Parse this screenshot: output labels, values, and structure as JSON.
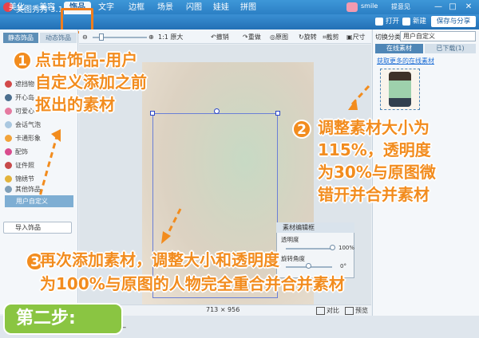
{
  "window": {
    "title": "美图秀秀 3.1.2",
    "user_name": "smile",
    "feedback": "提意见",
    "controls": [
      "—",
      "□",
      "✕"
    ]
  },
  "menu": {
    "tabs": [
      "美化",
      "美容",
      "饰品",
      "文字",
      "边框",
      "场景",
      "闪图",
      "娃娃",
      "拼图"
    ],
    "active_index": 2,
    "actions": {
      "open": "打开",
      "new": "新建",
      "save_share": "保存与分享"
    }
  },
  "left_panel": {
    "tabs": [
      "静态饰品",
      "动态饰品"
    ],
    "items": [
      "遮挡物",
      "开心岛",
      "可爱心",
      "会话气泡",
      "卡通形象",
      "配饰",
      "证件照",
      "锦绣节",
      "其他饰品"
    ],
    "custom": "用户自定义",
    "import_button": "导入饰品"
  },
  "toolbar": {
    "zoom_label": "1:1 原大",
    "undo": "撤销",
    "redo": "重做",
    "original": "原图",
    "rotate": "旋转",
    "crop": "截剪",
    "size": "尺寸"
  },
  "status": {
    "size_text": "713 × 956",
    "compare": "对比",
    "preview": "预览"
  },
  "material_editor": {
    "title": "素材编辑框",
    "opacity_label": "透明度",
    "opacity_value": "100%",
    "rotation_label": "旋转角度",
    "rotation_value": "0°"
  },
  "right_panel": {
    "category_label": "切换分类",
    "category_value": "用户自定义",
    "tabs": [
      "在线素材",
      "已下载(1)"
    ],
    "link": "获取更多的在线素材"
  },
  "annotations": {
    "step1_num": "1",
    "step1_lines": [
      "点击饰品-用户",
      "自定义添加之前",
      "抠出的素材"
    ],
    "step2_num": "2",
    "step2_lines": [
      "调整素材大小为",
      "115%，透明度",
      "为30%与原图微",
      "错开并合并素材"
    ],
    "step3_num": "3",
    "step3_lines": [
      "再次添加素材，调整大小和透明度",
      "为100%与原图的人物完全重合并合并素材"
    ],
    "step_badge": "第二步:"
  },
  "bottom_bar": {
    "text": "一"
  },
  "colors": {
    "accent": "#f28c1e",
    "title_bar": "#2b7fc4",
    "badge": "#8ac542"
  }
}
